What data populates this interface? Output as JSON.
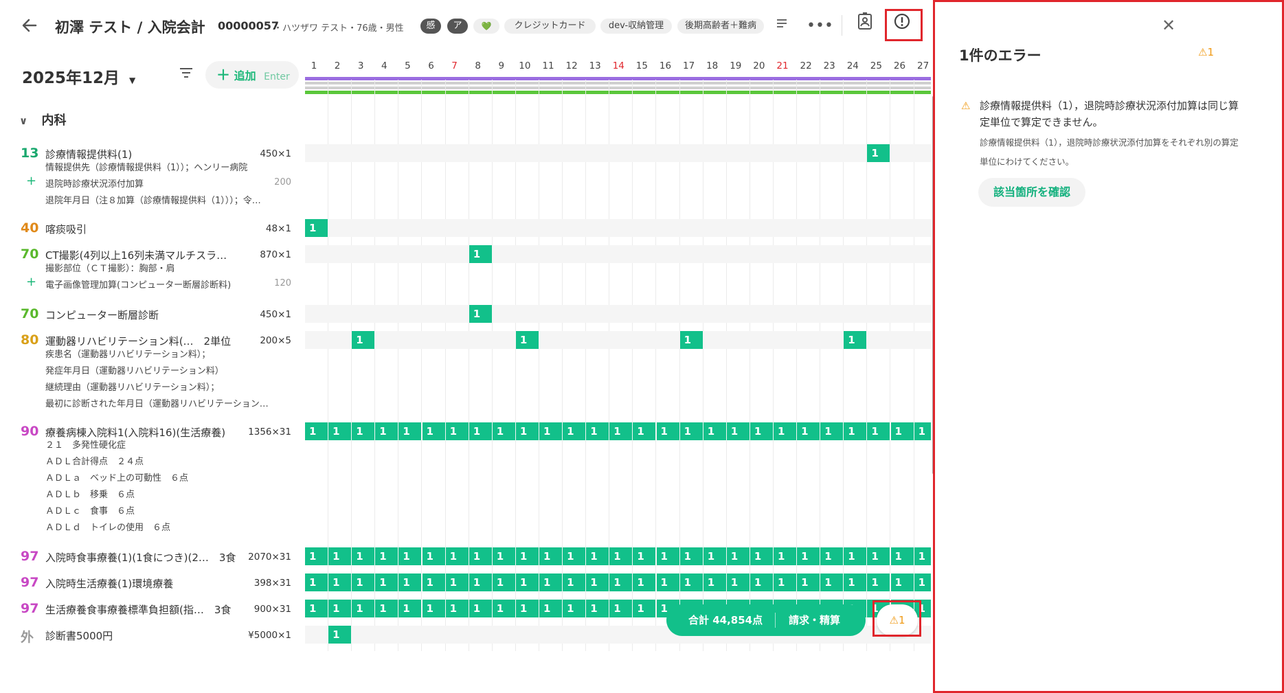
{
  "header": {
    "title": "初澤 テスト / 入院会計",
    "patient_id": "00000057",
    "patient_info": "・ハツザワ テスト・76歳・男性",
    "tags": [
      "感",
      "ア",
      "💚",
      "クレジットカード",
      "dev-収納管理",
      "後期高齢者＋難病"
    ]
  },
  "toolbar": {
    "month": "2025年12月",
    "add_label": "追加",
    "add_key": "Enter"
  },
  "days": [
    "1",
    "2",
    "3",
    "4",
    "5",
    "6",
    "7",
    "8",
    "9",
    "10",
    "11",
    "12",
    "13",
    "14",
    "15",
    "16",
    "17",
    "18",
    "19",
    "20",
    "21",
    "22",
    "23",
    "24",
    "25",
    "26",
    "27"
  ],
  "red_days": [
    "7",
    "14",
    "21"
  ],
  "section": "内科",
  "rows": [
    {
      "code": "13",
      "name": "診療情報提供料(1)",
      "qty": "450×1",
      "color": "#1aa86e",
      "subs": [
        {
          "text": "情報提供先（診療情報提供料（1））；ヘンリー病院"
        },
        {
          "plus": true,
          "text": "退院時診療状況添付加算",
          "qty": "200"
        },
        {
          "text": "退院年月日（注８加算（診療情報提供料（1）））；令…"
        }
      ]
    },
    {
      "code": "40",
      "name": "喀痰吸引",
      "qty": "48×1",
      "color": "#e08a1a",
      "subs": []
    },
    {
      "code": "70",
      "name": "CT撮影(4列以上16列未満マルチスラ…",
      "qty": "870×1",
      "color": "#5ab82d",
      "subs": [
        {
          "text": "撮影部位（ＣＴ撮影）：胸部・肩"
        },
        {
          "plus": true,
          "text": "電子画像管理加算(コンピューター断層診断料)",
          "qty": "120"
        }
      ]
    },
    {
      "code": "70",
      "name": "コンピューター断層診断",
      "qty": "450×1",
      "color": "#5ab82d",
      "subs": []
    },
    {
      "code": "80",
      "name": "運動器リハビリテーション料(…　2単位",
      "qty": "200×5",
      "color": "#d9a019",
      "subs": [
        {
          "text": "疾患名（運動器リハビリテーション料）；"
        },
        {
          "text": "発症年月日（運動器リハビリテーション料）"
        },
        {
          "text": "継続理由（運動器リハビリテーション料）；"
        },
        {
          "text": "最初に診断された年月日（運動器リハビリテーション…"
        }
      ]
    },
    {
      "code": "90",
      "name": "療養病棟入院料1(入院料16)(生活療養)",
      "qty": "1356×31",
      "color": "#c848c4",
      "subs": [
        {
          "text": "２１　多発性硬化症"
        },
        {
          "text": "ＡＤＬ合計得点　２４点"
        },
        {
          "text": "ＡＤＬａ　ベッド上の可動性　６点"
        },
        {
          "text": "ＡＤＬｂ　移乗　６点"
        },
        {
          "text": "ＡＤＬｃ　食事　６点"
        },
        {
          "text": "ＡＤＬｄ　トイレの使用　６点"
        }
      ]
    },
    {
      "code": "97",
      "name": "入院時食事療養(1)(1食につき)(2…　3食",
      "qty": "2070×31",
      "color": "#c848c4",
      "subs": []
    },
    {
      "code": "97",
      "name": "入院時生活療養(1)環境療養",
      "qty": "398×31",
      "color": "#c848c4",
      "subs": []
    },
    {
      "code": "97",
      "name": "生活療養食事療養標準負担額(指…　3食",
      "qty": "900×31",
      "color": "#c848c4",
      "subs": []
    },
    {
      "code": "外",
      "name": "診断書5000円",
      "qty": "¥5000×1",
      "color": "#999999",
      "subs": []
    }
  ],
  "footer": {
    "total": "合計 44,854点",
    "bill": "請求・精算",
    "warn_count": "1"
  },
  "panel": {
    "title": "1件のエラー",
    "badge": "1",
    "error_main": "診療情報提供料（1），退院時診療状況添付加算は同じ算定単位で算定できません。",
    "error_detail": "診療情報提供料（1），退院時診療状況添付加算をそれぞれ別の算定単位にわけてください。",
    "confirm": "該当箇所を確認"
  },
  "colors": {
    "accent": "#12c08a",
    "warn": "#f09a14",
    "highlight": "#e0262c"
  }
}
